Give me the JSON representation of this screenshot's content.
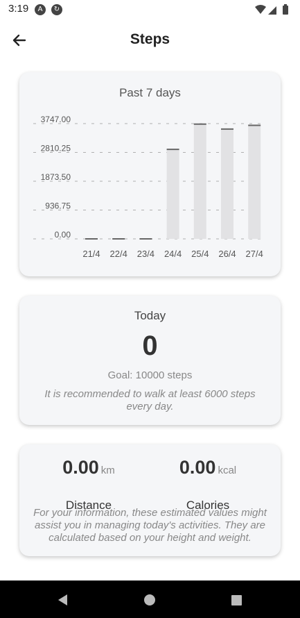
{
  "status_bar": {
    "time": "3:19",
    "icons_left": [
      "a-icon",
      "sync-icon"
    ],
    "icons_right": [
      "wifi-icon",
      "signal-icon",
      "battery-icon"
    ]
  },
  "app_bar": {
    "title": "Steps",
    "back_icon": "arrow-back-icon"
  },
  "chart_card": {
    "title": "Past 7 days"
  },
  "chart_data": {
    "type": "bar",
    "title": "Past 7 days",
    "categories": [
      "21/4",
      "22/4",
      "23/4",
      "24/4",
      "25/4",
      "26/4",
      "27/4"
    ],
    "values": [
      0,
      0,
      0,
      2910,
      3730,
      3570,
      3690
    ],
    "y_ticks": [
      "0.00",
      "936.75",
      "1873.50",
      "2810.25",
      "3747.00"
    ],
    "ylim": [
      0,
      3747
    ],
    "grid": true,
    "bar_color": "#e2e2e4",
    "bar_top_color": "#666666"
  },
  "today": {
    "label": "Today",
    "steps": "0",
    "goal": "Goal: 10000 steps",
    "recommendation": "It is recommended to walk at least 6000 steps every day."
  },
  "metrics": {
    "distance": {
      "value": "0.00",
      "unit": "km",
      "label": "Distance"
    },
    "calories": {
      "value": "0.00",
      "unit": "kcal",
      "label": "Calories"
    },
    "note": "For your information, these estimated values might assist you in managing today's activities. They are calculated based on your height and weight."
  },
  "nav_bar": {
    "buttons": [
      "back-triangle-icon",
      "home-circle-icon",
      "recents-square-icon"
    ]
  }
}
